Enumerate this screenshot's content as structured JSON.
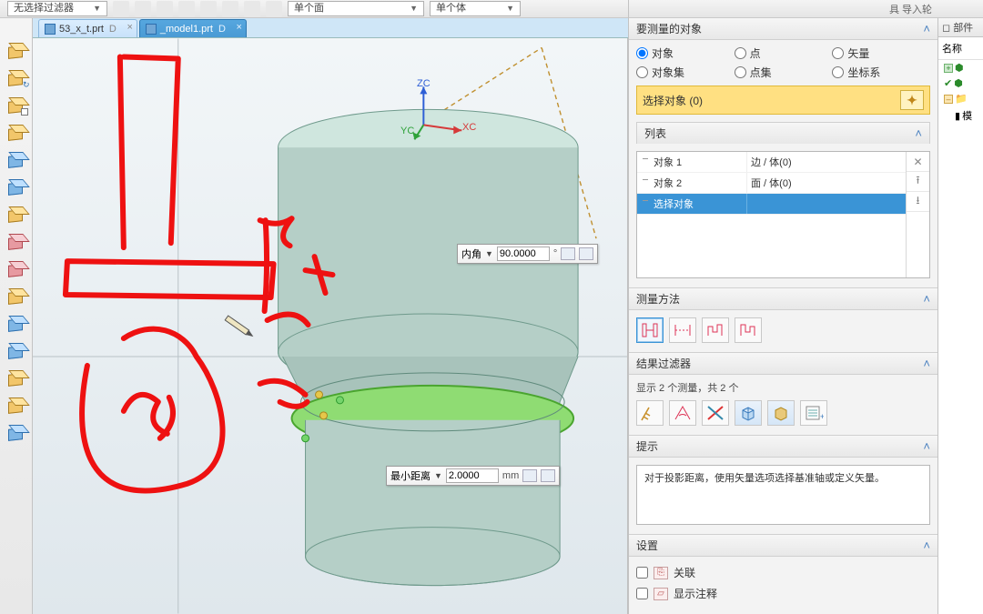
{
  "ribbon": {
    "filter_left": "无选择过滤器",
    "face_mode": "单个面",
    "body_mode": "单个体",
    "menuright": "具  导入轮"
  },
  "tabs": [
    {
      "label": "53_x_t.prt",
      "dirty": "D",
      "active": false
    },
    {
      "label": "_model1.prt",
      "dirty": "D",
      "active": true
    }
  ],
  "axes": {
    "zc": "ZC",
    "yc": "YC",
    "xc": "XC"
  },
  "callouts": {
    "angle_label": "内角",
    "angle_value": "90.0000",
    "angle_unit": "°",
    "dist_label": "最小距离",
    "dist_value": "2.0000",
    "dist_unit": "mm"
  },
  "panel": {
    "header_cut": "要测量的对象",
    "radios": {
      "r1": "对象",
      "r2": "点",
      "r3": "矢量",
      "r4": "对象集",
      "r5": "点集",
      "r6": "坐标系"
    },
    "select_label": "选择对象 (0)",
    "list_title": "列表",
    "list_rows": [
      {
        "c1": "对象 1",
        "c2": "边 / 体(0)"
      },
      {
        "c1": "对象 2",
        "c2": "面 / 体(0)"
      },
      {
        "c1": "选择对象",
        "c2": "",
        "selected": true
      }
    ],
    "method_title": "测量方法",
    "filter_title": "结果过滤器",
    "filter_summary": "显示 2 个测量，共 2 个",
    "tip_title": "提示",
    "tip_body": "对于投影距离，使用矢量选项选择基准轴或定义矢量。",
    "settings_title": "设置",
    "setting_assoc": "关联",
    "setting_annot": "显示注释"
  },
  "farright": {
    "top": "部件",
    "name": "名称",
    "node3": "模"
  }
}
